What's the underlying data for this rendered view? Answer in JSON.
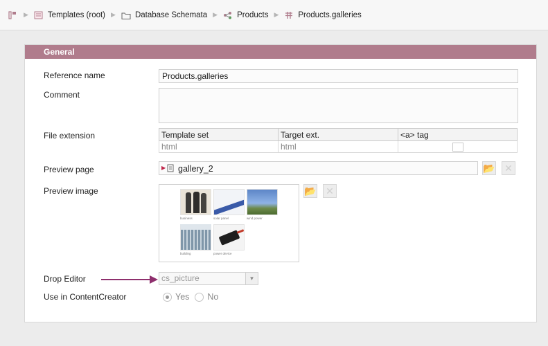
{
  "breadcrumb": [
    {
      "label": "Templates (root)",
      "icon": "template-root-icon"
    },
    {
      "label": "Database Schemata",
      "icon": "folder-icon"
    },
    {
      "label": "Products",
      "icon": "schema-icon"
    },
    {
      "label": "Products.galleries",
      "icon": "table-template-icon"
    }
  ],
  "section": {
    "title": "General"
  },
  "fields": {
    "reference_name_label": "Reference name",
    "reference_name_value": "Products.galleries",
    "comment_label": "Comment",
    "comment_value": "",
    "file_extension_label": "File extension",
    "preview_page_label": "Preview page",
    "preview_page_value": "gallery_2",
    "preview_image_label": "Preview image",
    "drop_editor_label": "Drop Editor",
    "drop_editor_value": "cs_picture",
    "use_in_cc_label": "Use in ContentCreator",
    "yes_label": "Yes",
    "no_label": "No"
  },
  "file_ext_table": {
    "headers": [
      "Template set",
      "Target ext.",
      "<a> tag"
    ],
    "rows": [
      {
        "template_set": "html",
        "target_ext": "html",
        "a_tag": false
      }
    ]
  },
  "preview_images": [
    {
      "caption": "business",
      "tone": "people"
    },
    {
      "caption": "solar panel",
      "tone": "solar"
    },
    {
      "caption": "wind power",
      "tone": "sky"
    },
    {
      "caption": "building",
      "tone": "building"
    },
    {
      "caption": "power device",
      "tone": "device"
    }
  ],
  "colors": {
    "section_header": "#b07c8c",
    "arrow": "#8e2f6d"
  }
}
